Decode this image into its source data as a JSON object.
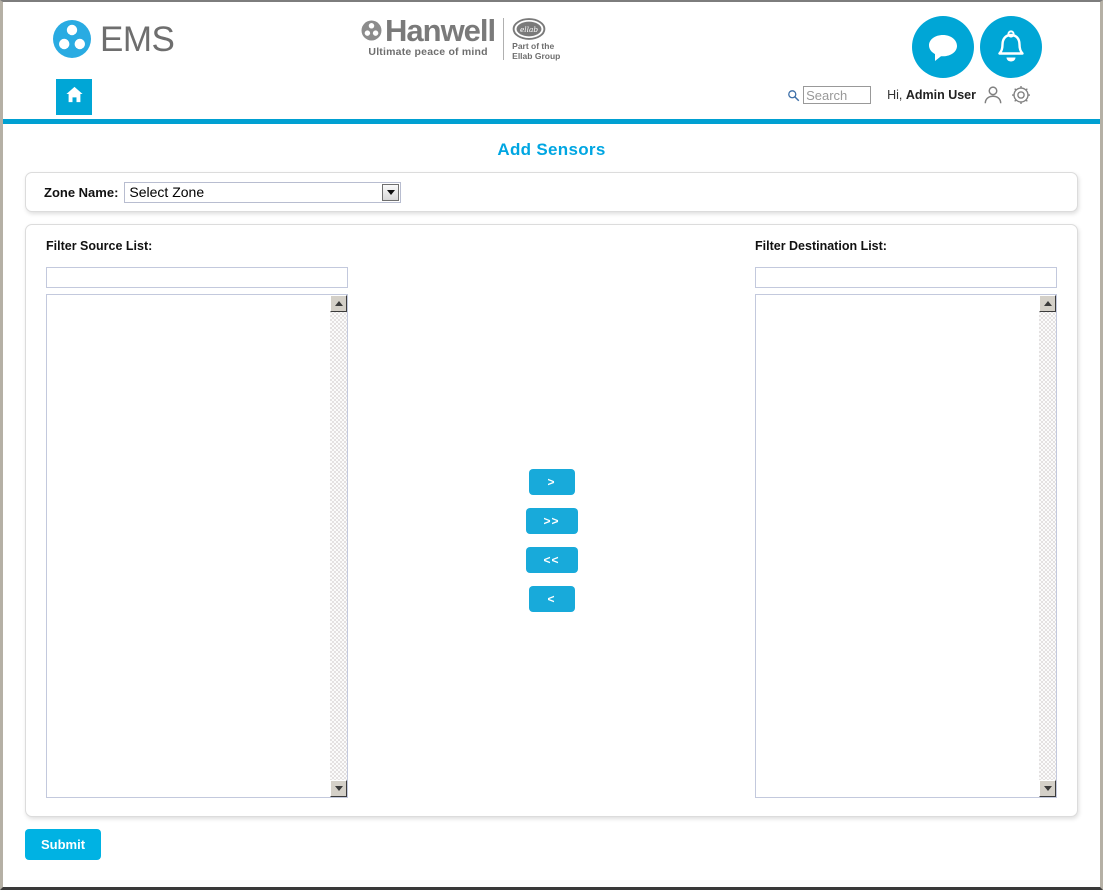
{
  "header": {
    "ems_logo_text": "EMS",
    "ems_logo_icon": "ems-triskelion-icon",
    "hanwell_name": "Hanwell",
    "hanwell_tagline": "Ultimate peace of mind",
    "hanwell_icon": "hanwell-triskelion-icon",
    "ellab_badge_text": "ellab",
    "ellab_line1": "Part of the",
    "ellab_line2": "Ellab Group",
    "chat_icon": "chat-bubble-icon",
    "bell_icon": "bell-icon"
  },
  "nav": {
    "home_icon": "home-icon",
    "search_icon": "search-icon",
    "search_value": "",
    "search_placeholder": "Search",
    "greeting_prefix": "Hi,",
    "user_name": "Admin User",
    "person_icon": "user-profile-icon",
    "gear_icon": "gear-icon"
  },
  "page": {
    "title": "Add Sensors"
  },
  "zone": {
    "label": "Zone Name:",
    "selected": "Select Zone",
    "options": [
      "Select Zone"
    ],
    "dropdown_icon": "chevron-down-icon"
  },
  "source": {
    "label": "Filter Source List:",
    "filter_value": "",
    "filter_placeholder": "",
    "items": [],
    "scroll_up_icon": "scroll-up-arrow-icon",
    "scroll_down_icon": "scroll-down-arrow-icon"
  },
  "destination": {
    "label": "Filter Destination List:",
    "filter_value": "",
    "filter_placeholder": "",
    "items": [],
    "scroll_up_icon": "scroll-up-arrow-icon",
    "scroll_down_icon": "scroll-down-arrow-icon"
  },
  "transfer_buttons": {
    "move_right": ">",
    "move_all_right": ">>",
    "move_all_left": "<<",
    "move_left": "<"
  },
  "actions": {
    "submit_label": "Submit"
  },
  "colors": {
    "accent_cyan": "#00a6d6",
    "title_cyan": "#00a6e2",
    "button_cyan": "#18aada",
    "submit_cyan": "#00b2e3",
    "logo_gray": "#6e6e6e"
  }
}
